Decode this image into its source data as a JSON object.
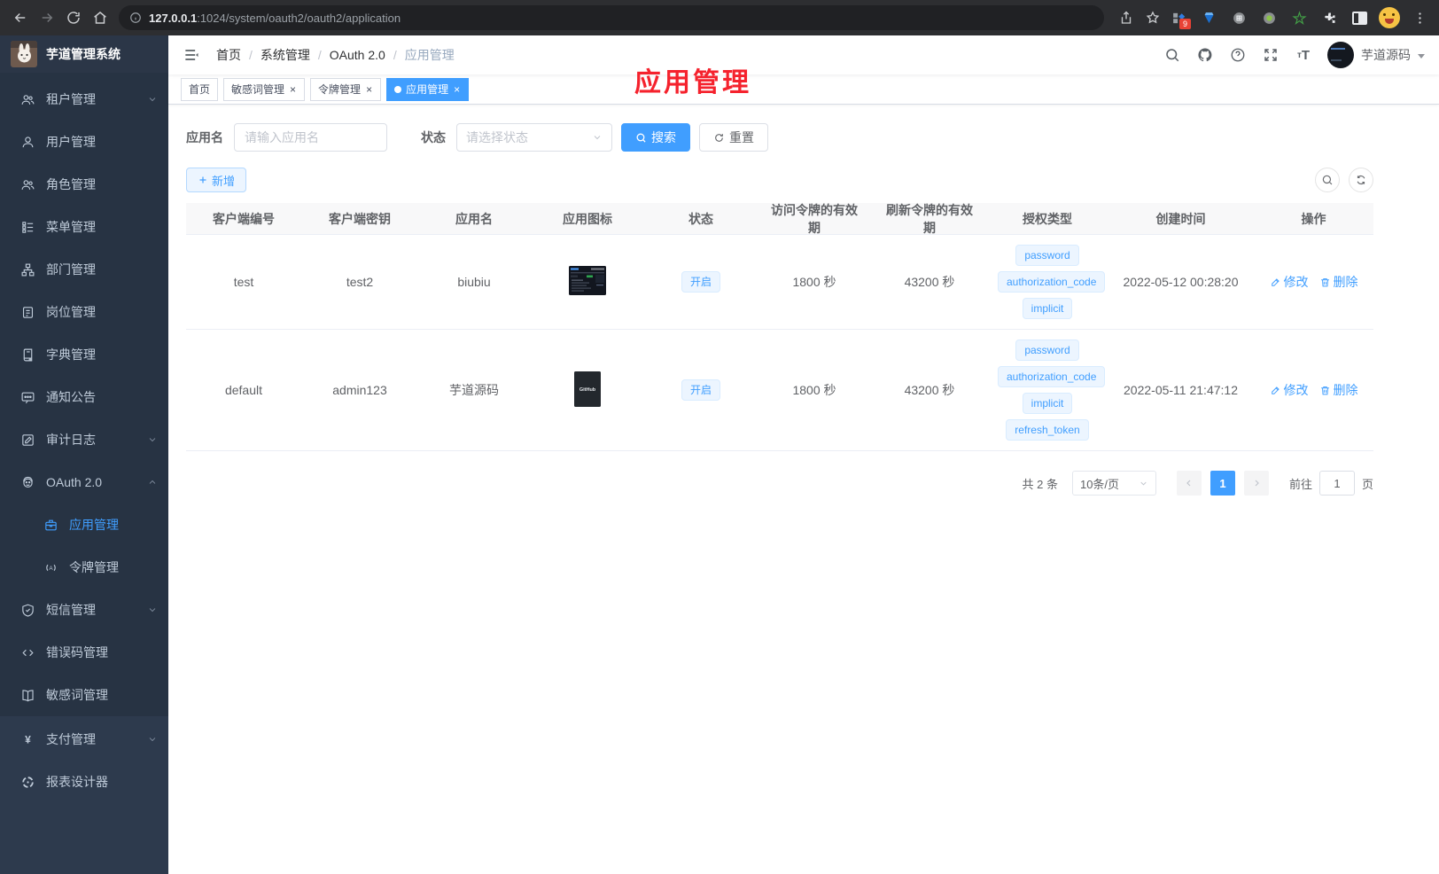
{
  "browser": {
    "url_host": "127.0.0.1",
    "url_rest": ":1024/system/oauth2/oauth2/application",
    "extension_badge": "9"
  },
  "sidebar": {
    "logo_title": "芋道管理系统",
    "items": [
      {
        "id": "tenant",
        "label": "租户管理",
        "icon": "users",
        "chevron": "down"
      },
      {
        "id": "user",
        "label": "用户管理",
        "icon": "user"
      },
      {
        "id": "role",
        "label": "角色管理",
        "icon": "users"
      },
      {
        "id": "menu",
        "label": "菜单管理",
        "icon": "tree"
      },
      {
        "id": "dept",
        "label": "部门管理",
        "icon": "org"
      },
      {
        "id": "post",
        "label": "岗位管理",
        "icon": "badge"
      },
      {
        "id": "dict",
        "label": "字典管理",
        "icon": "dictbook"
      },
      {
        "id": "notice",
        "label": "通知公告",
        "icon": "message"
      },
      {
        "id": "audit-log",
        "label": "审计日志",
        "icon": "logpen",
        "chevron": "down"
      },
      {
        "id": "oauth2",
        "label": "OAuth 2.0",
        "icon": "robot",
        "chevron": "up"
      },
      {
        "id": "oauth2-application",
        "label": "应用管理",
        "icon": "briefcase",
        "sub": true,
        "active": true
      },
      {
        "id": "oauth2-token",
        "label": "令牌管理",
        "icon": "token",
        "sub": true
      },
      {
        "id": "sms",
        "label": "短信管理",
        "icon": "shield",
        "chevron": "down"
      },
      {
        "id": "error-code",
        "label": "错误码管理",
        "icon": "code"
      },
      {
        "id": "sensitive-word",
        "label": "敏感词管理",
        "icon": "book"
      },
      {
        "id": "pay",
        "label": "支付管理",
        "icon": "yen",
        "chevron": "down",
        "section": "bottom"
      },
      {
        "id": "report-designer",
        "label": "报表设计器",
        "icon": "report",
        "section": "bottom"
      }
    ]
  },
  "header": {
    "breadcrumb": [
      "首页",
      "系统管理",
      "OAuth 2.0",
      "应用管理"
    ],
    "user_name": "芋道源码"
  },
  "annotation": {
    "text": "应用管理",
    "color": "#f5222d"
  },
  "tabs": [
    {
      "label": "首页",
      "closable": false,
      "active": false
    },
    {
      "label": "敏感词管理",
      "closable": true,
      "active": false
    },
    {
      "label": "令牌管理",
      "closable": true,
      "active": false
    },
    {
      "label": "应用管理",
      "closable": true,
      "active": true
    }
  ],
  "filters": {
    "name_label": "应用名",
    "name_placeholder": "请输入应用名",
    "status_label": "状态",
    "status_placeholder": "请选择状态",
    "search_label": "搜索",
    "reset_label": "重置"
  },
  "toolbar": {
    "add_label": "新增"
  },
  "table": {
    "columns": [
      {
        "id": "client_id",
        "label": "客户端编号"
      },
      {
        "id": "secret",
        "label": "客户端密钥"
      },
      {
        "id": "name",
        "label": "应用名"
      },
      {
        "id": "icon",
        "label": "应用图标"
      },
      {
        "id": "status",
        "label": "状态"
      },
      {
        "id": "access_ttl",
        "label": "访问令牌的有效期"
      },
      {
        "id": "refresh_ttl",
        "label": "刷新令牌的有效期"
      },
      {
        "id": "grant_types",
        "label": "授权类型"
      },
      {
        "id": "create_time",
        "label": "创建时间"
      },
      {
        "id": "actions",
        "label": "操作"
      }
    ],
    "rows": [
      {
        "client_id": "test",
        "secret": "test2",
        "name": "biubiu",
        "icon": "dashboard-screenshot",
        "status": "开启",
        "access_ttl": "1800 秒",
        "refresh_ttl": "43200 秒",
        "grant_types": [
          "password",
          "authorization_code",
          "implicit"
        ],
        "create_time": "2022-05-12 00:28:20"
      },
      {
        "client_id": "default",
        "secret": "admin123",
        "name": "芋道源码",
        "icon": "github-dark",
        "status": "开启",
        "access_ttl": "1800 秒",
        "refresh_ttl": "43200 秒",
        "grant_types": [
          "password",
          "authorization_code",
          "implicit",
          "refresh_token"
        ],
        "create_time": "2022-05-11 21:47:12"
      }
    ],
    "actions": {
      "edit": "修改",
      "delete": "删除"
    }
  },
  "pagination": {
    "total": "共 2 条",
    "page_size": "10条/页",
    "current_page": "1",
    "goto_label": "前往",
    "goto_value": "1",
    "page_unit": "页"
  },
  "colors": {
    "accent": "#409eff",
    "tag_bg": "#ecf5ff",
    "annotation": "#f5222d"
  }
}
